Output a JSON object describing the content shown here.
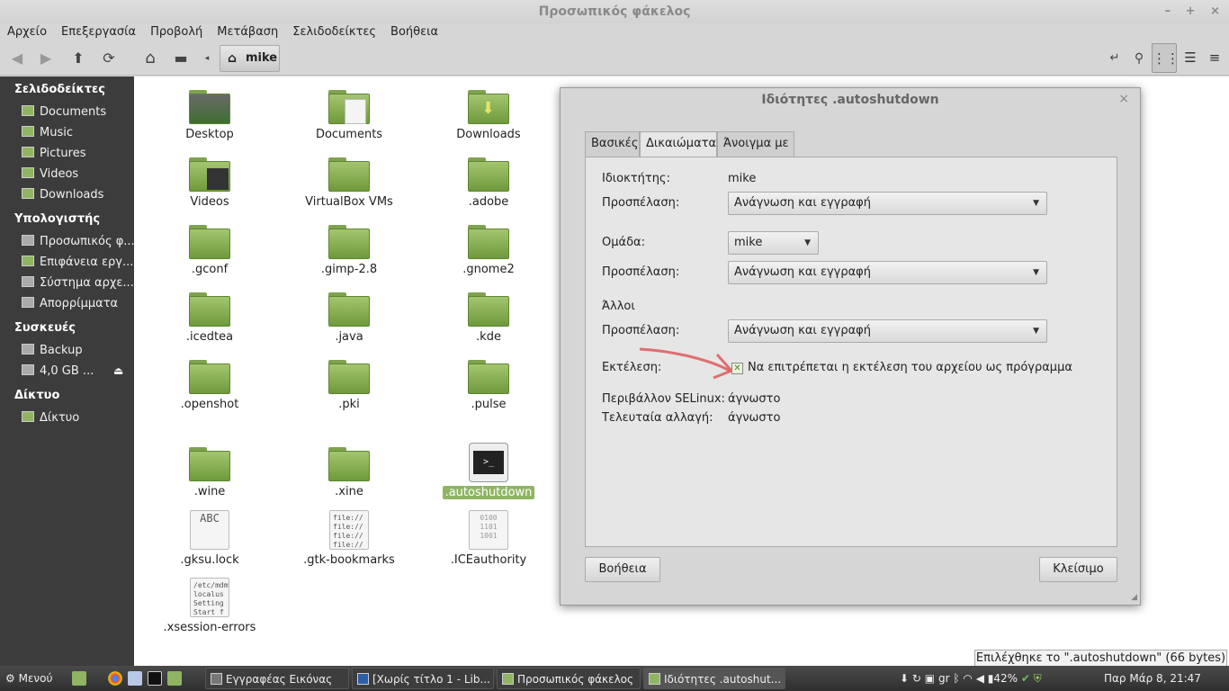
{
  "window": {
    "title": "Προσωπικός φάκελος",
    "controls": [
      "–",
      "+",
      "×"
    ]
  },
  "menubar": [
    "Αρχείο",
    "Επεξεργασία",
    "Προβολή",
    "Μετάβαση",
    "Σελιδοδείκτες",
    "Βοήθεια"
  ],
  "toolbar": {
    "breadcrumb": "mike"
  },
  "sidebar": {
    "sections": [
      {
        "title": "Σελιδοδείκτες",
        "items": [
          "Documents",
          "Music",
          "Pictures",
          "Videos",
          "Downloads"
        ]
      },
      {
        "title": "Υπολογιστής",
        "items": [
          "Προσωπικός φ...",
          "Επιφάνεια εργ...",
          "Σύστημα αρχε...",
          "Απορρίμματα"
        ]
      },
      {
        "title": "Συσκευές",
        "items": [
          "Backup",
          "4,0 GB ..."
        ]
      },
      {
        "title": "Δίκτυο",
        "items": [
          "Δίκτυο"
        ]
      }
    ]
  },
  "files": [
    "Desktop",
    "Documents",
    "Downloads",
    "Videos",
    "VirtualBox VMs",
    ".adobe",
    ".gconf",
    ".gimp-2.8",
    ".gnome2",
    ".icedtea",
    ".java",
    ".kde",
    ".openshot",
    ".pki",
    ".pulse",
    ".wine",
    ".xine",
    ".autoshutdown",
    ".gksu.lock",
    ".gtk-bookmarks",
    ".ICEauthority",
    ".xsession-errors"
  ],
  "file_icon_text": {
    "gksu": "ABC",
    "gtk": "file://\nfile://\nfile://\nfile://",
    "ice": "0100\n1101\n1001",
    "xsession": "/etc/mdm\nlocalus\nSetting\nStart f"
  },
  "dialog": {
    "title": "Ιδιότητες .autoshutdown",
    "tabs": [
      "Βασικές",
      "Δικαιώματα",
      "Άνοιγμα με"
    ],
    "owner_label": "Ιδιοκτήτης:",
    "owner_value": "mike",
    "access_label": "Προσπέλαση:",
    "owner_access": "Ανάγνωση και εγγραφή",
    "group_label": "Ομάδα:",
    "group_value": "mike",
    "group_access": "Ανάγνωση και εγγραφή",
    "others_label": "Άλλοι",
    "others_access": "Ανάγνωση και εγγραφή",
    "exec_label": "Εκτέλεση:",
    "exec_checkbox": "Να επιτρέπεται η εκτέλεση του αρχείου ως πρόγραμμα",
    "exec_checked": true,
    "selinux_label": "Περιβάλλον SELinux:",
    "selinux_value": "άγνωστο",
    "modified_label": "Τελευταία αλλαγή:",
    "modified_value": "άγνωστο",
    "help_button": "Βοήθεια",
    "close_button": "Κλείσιμο"
  },
  "statusbar": "Επιλέχθηκε το \".autoshutdown\" (66 bytes)",
  "taskbar": {
    "menu": "Μενού",
    "windows": [
      "Εγγραφέας Εικόνας",
      "[Χωρίς τίτλο 1 - Lib...",
      "Προσωπικός φάκελος",
      "Ιδιότητες .autoshut..."
    ],
    "keyboard": "gr",
    "battery": "42%",
    "clock": "Παρ Μάρ  8, 21:47"
  },
  "colors": {
    "sidebar_bg": "#3c3c3c",
    "accent_green": "#8fb563",
    "annotation_arrow": "#e05050"
  }
}
